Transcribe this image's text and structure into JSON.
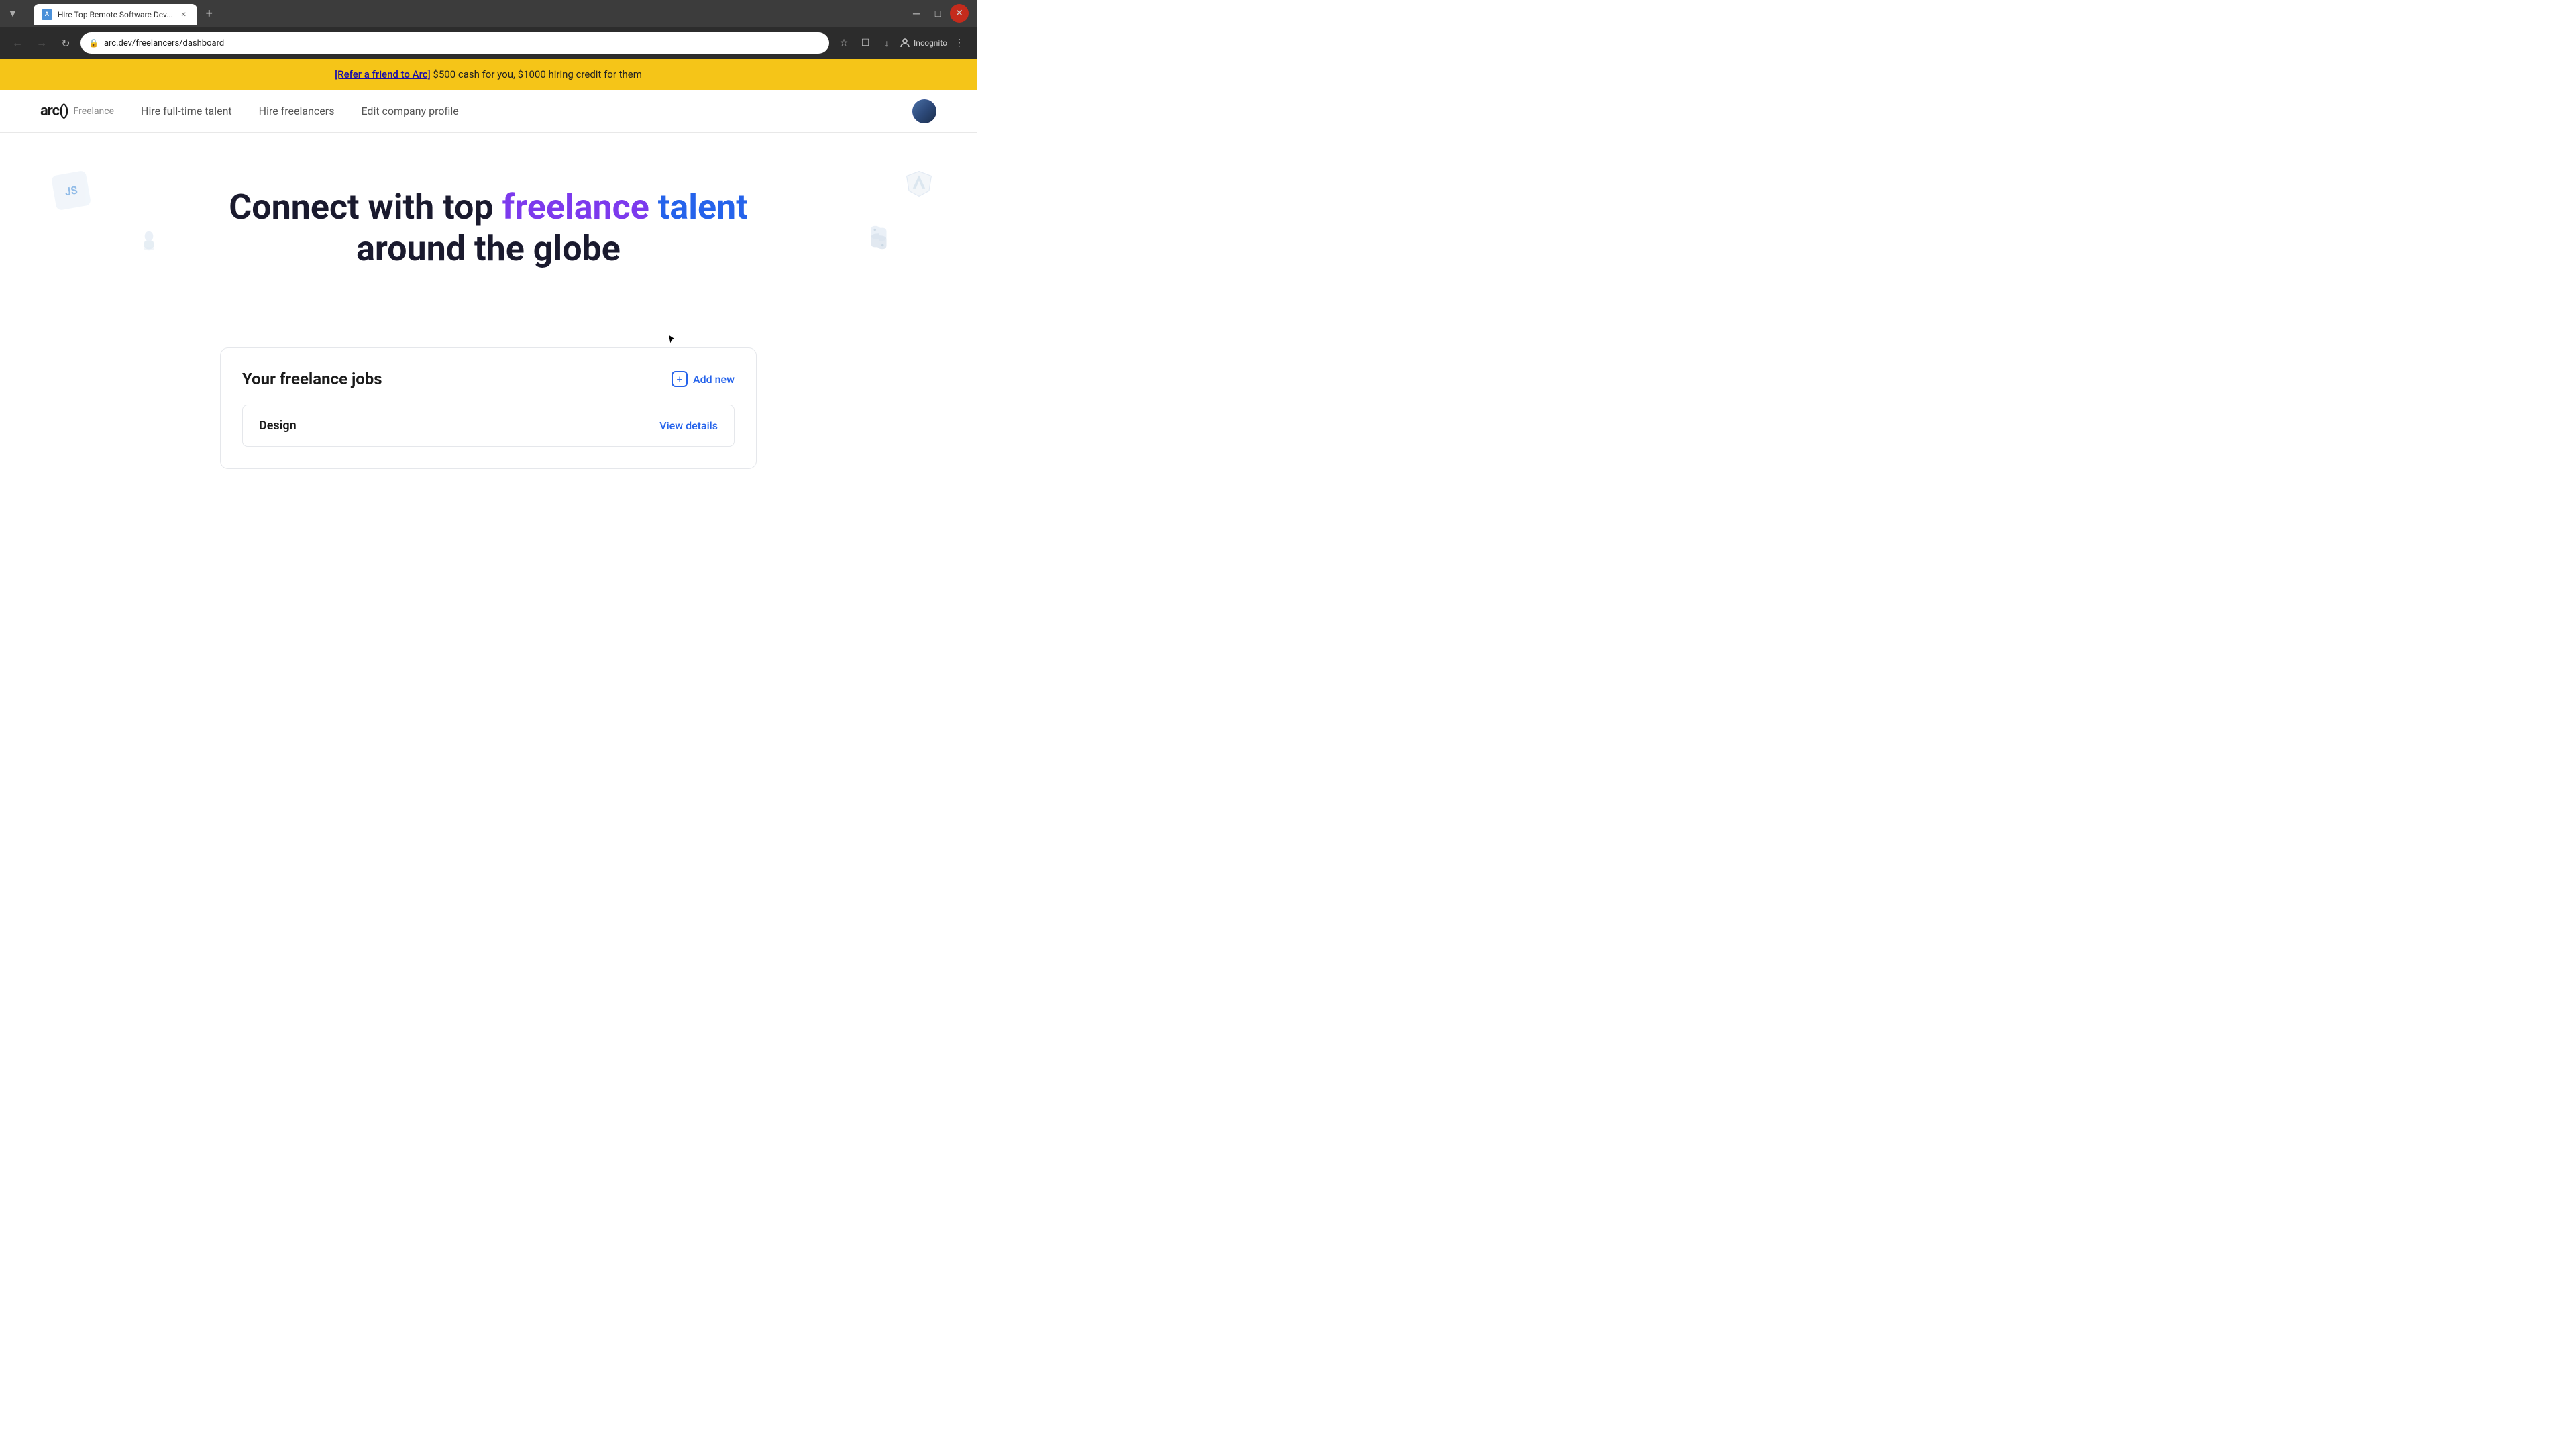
{
  "browser": {
    "tab_title": "Hire Top Remote Software Dev...",
    "tab_favicon": "A",
    "url": "arc.dev/freelancers/dashboard",
    "new_tab_label": "+",
    "nav": {
      "back_disabled": true,
      "forward_disabled": true
    },
    "incognito_label": "Incognito",
    "window_controls": {
      "minimize": "─",
      "maximize": "□",
      "close": "✕"
    }
  },
  "banner": {
    "link_text": "[Refer a friend to Arc]",
    "message": " $500 cash for you, $1000 hiring credit for them"
  },
  "nav": {
    "logo_text": "arc()",
    "logo_tag": "Freelance",
    "links": [
      {
        "label": "Hire full-time talent",
        "active": false
      },
      {
        "label": "Hire freelancers",
        "active": false
      },
      {
        "label": "Edit company profile",
        "active": false
      }
    ]
  },
  "hero": {
    "title_part1": "Connect with top ",
    "title_accent1": "freelance",
    "title_space": " ",
    "title_accent2": "talent",
    "title_part2": " around the globe"
  },
  "jobs": {
    "section_title": "Your freelance jobs",
    "add_new_label": "Add new",
    "items": [
      {
        "name": "Design",
        "view_label": "View details"
      }
    ]
  },
  "colors": {
    "accent_purple": "#7c3aed",
    "accent_blue": "#2563eb",
    "banner_bg": "#f5c518",
    "banner_link": "#1a0dab"
  }
}
